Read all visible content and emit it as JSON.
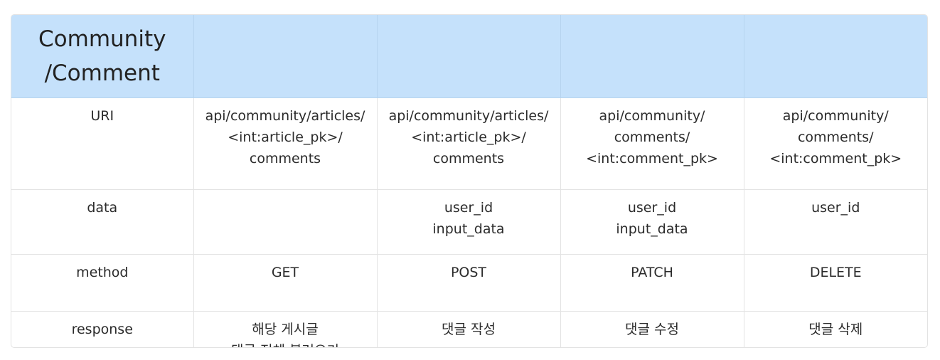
{
  "table": {
    "header": {
      "title": "Community\n/Comment",
      "cols": [
        "",
        "",
        "",
        ""
      ]
    },
    "rows": [
      {
        "label": "URI",
        "cells": [
          "api/community/articles/\n<int:article_pk>/\ncomments",
          "api/community/articles/\n<int:article_pk>/\ncomments",
          "api/community/\ncomments/\n<int:comment_pk>",
          "api/community/\ncomments/\n<int:comment_pk>"
        ]
      },
      {
        "label": "data",
        "cells": [
          "",
          "user_id\ninput_data",
          "user_id\ninput_data",
          "user_id"
        ]
      },
      {
        "label": "method",
        "cells": [
          "GET",
          "POST",
          "PATCH",
          "DELETE"
        ]
      },
      {
        "label": "response",
        "cells": [
          "해당 게시글\n댓글 전체 불러오기",
          "댓글 작성",
          "댓글 수정",
          "댓글 삭제"
        ]
      }
    ]
  },
  "colors": {
    "header_bg": "#c5e1fb",
    "border": "#e3e3e3",
    "text": "#2b2b2b"
  }
}
